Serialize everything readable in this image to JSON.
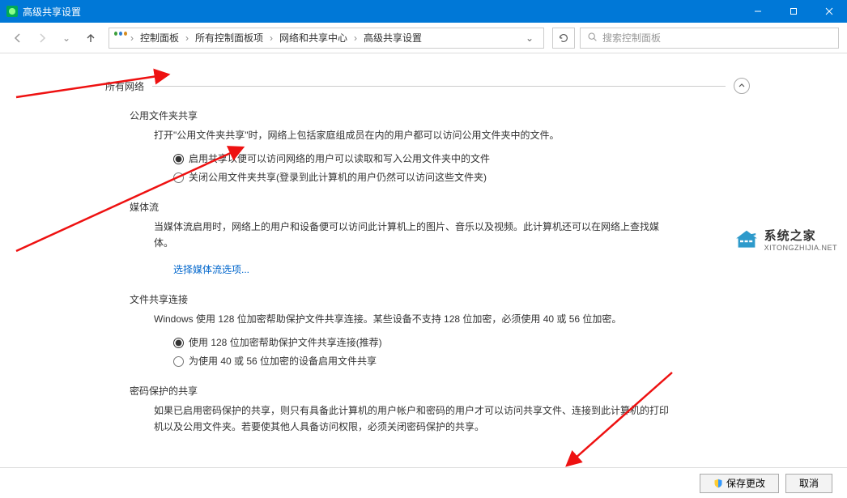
{
  "window": {
    "title": "高级共享设置",
    "controls": {
      "min": "minimize",
      "max": "maximize",
      "close": "close"
    }
  },
  "navbar": {
    "breadcrumb": [
      "控制面板",
      "所有控制面板项",
      "网络和共享中心",
      "高级共享设置"
    ],
    "search_placeholder": "搜索控制面板"
  },
  "section_header": "所有网络",
  "public_folder": {
    "title": "公用文件夹共享",
    "desc": "打开\"公用文件夹共享\"时，网络上包括家庭组成员在内的用户都可以访问公用文件夹中的文件。",
    "opt_on": "启用共享以便可以访问网络的用户可以读取和写入公用文件夹中的文件",
    "opt_off": "关闭公用文件夹共享(登录到此计算机的用户仍然可以访问这些文件夹)",
    "selected": "on"
  },
  "media_stream": {
    "title": "媒体流",
    "desc": "当媒体流启用时，网络上的用户和设备便可以访问此计算机上的图片、音乐以及视频。此计算机还可以在网络上查找媒体。",
    "link": "选择媒体流选项..."
  },
  "file_conn": {
    "title": "文件共享连接",
    "desc": "Windows 使用 128 位加密帮助保护文件共享连接。某些设备不支持 128 位加密，必须使用 40 或 56 位加密。",
    "opt128": "使用 128 位加密帮助保护文件共享连接(推荐)",
    "opt40": "为使用 40 或 56 位加密的设备启用文件共享",
    "selected": "128"
  },
  "password_protect": {
    "title": "密码保护的共享",
    "desc": "如果已启用密码保护的共享，则只有具备此计算机的用户帐户和密码的用户才可以访问共享文件、连接到此计算机的打印机以及公用文件夹。若要使其他人具备访问权限，必须关闭密码保护的共享。"
  },
  "footer": {
    "save": "保存更改",
    "cancel": "取消"
  },
  "watermark": {
    "main": "系统之家",
    "sub": "XITONGZHIJIA.NET"
  }
}
